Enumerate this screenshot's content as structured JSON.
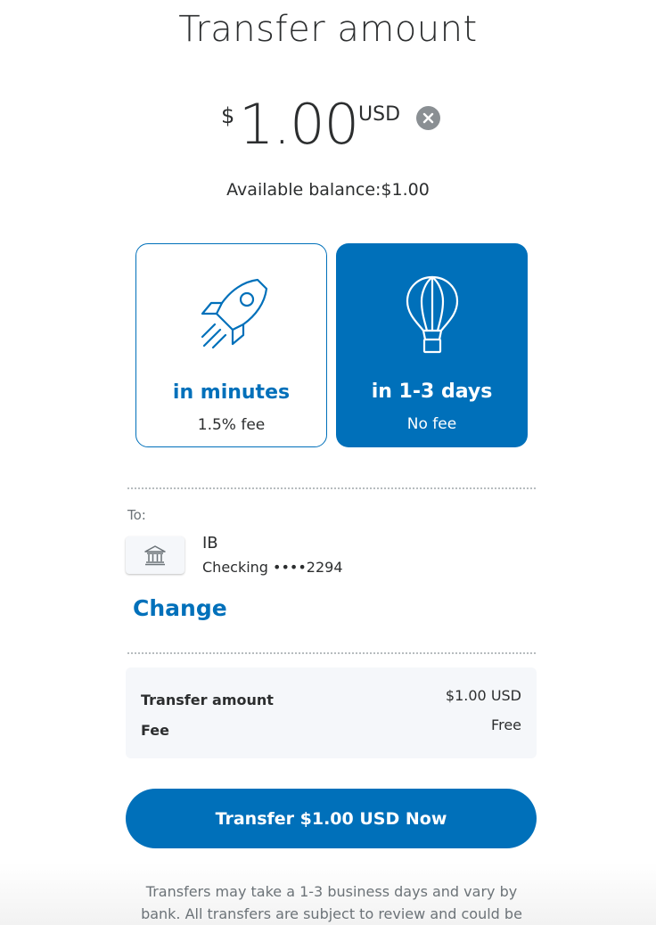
{
  "page": {
    "title": "Transfer amount"
  },
  "amount": {
    "currency_symbol": "$",
    "value": "1.00",
    "currency_code": "USD",
    "clear_icon": "close-circle-icon"
  },
  "balance": {
    "text": "Available balance:$1.00"
  },
  "speed_options": [
    {
      "title": "in minutes",
      "subtitle": "1.5% fee",
      "icon": "rocket-icon",
      "selected": false
    },
    {
      "title": "in 1-3 days",
      "subtitle": "No fee",
      "icon": "hot-air-balloon-icon",
      "selected": true
    }
  ],
  "destination": {
    "label": "To:",
    "bank_icon": "bank-icon",
    "bank_name": "IB",
    "account": "Checking ••••2294",
    "change_label": "Change"
  },
  "summary": {
    "rows": [
      {
        "label": "Transfer amount",
        "value": "$1.00 USD"
      },
      {
        "label": "Fee",
        "value": "Free"
      }
    ]
  },
  "cta": {
    "label": "Transfer $1.00 USD Now"
  },
  "disclaimer": {
    "line1": "Transfers may take a 1-3 business days and vary by",
    "line2": "bank. All transfers are subject to review and could be"
  },
  "colors": {
    "accent": "#0070ba",
    "text": "#2c2e2f",
    "muted": "#6c7378",
    "panel": "#f5f7fa"
  }
}
